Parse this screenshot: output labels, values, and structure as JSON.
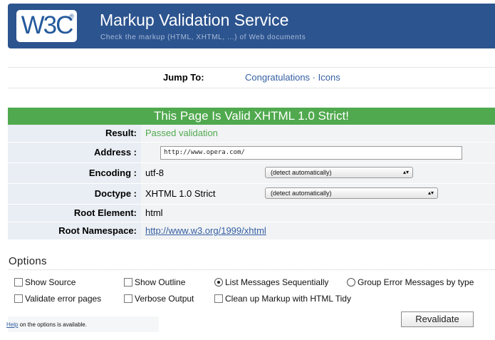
{
  "header": {
    "logo_text": "W3C",
    "logo_reg": "®",
    "title": "Markup Validation Service",
    "subtitle": "Check the markup (HTML, XHTML, ...) of Web documents"
  },
  "jump": {
    "label": "Jump To:",
    "link1": "Congratulations",
    "separator": " · ",
    "link2": "Icons"
  },
  "result": {
    "banner": "This Page Is Valid XHTML 1.0 Strict!",
    "rows": {
      "result_label": "Result:",
      "result_value": "Passed validation",
      "address_label": "Address :",
      "address_value": "http://www.opera.com/",
      "encoding_label": "Encoding :",
      "encoding_value": "utf-8",
      "encoding_select": "(detect automatically)",
      "doctype_label": "Doctype :",
      "doctype_value": "XHTML 1.0 Strict",
      "doctype_select": "(detect automatically)",
      "root_element_label": "Root Element:",
      "root_element_value": "html",
      "root_ns_label": "Root Namespace:",
      "root_ns_value": "http://www.w3.org/1999/xhtml"
    }
  },
  "options": {
    "title": "Options",
    "show_source": "Show Source",
    "show_outline": "Show Outline",
    "list_sequential": "List Messages Sequentially",
    "group_errors": "Group Error Messages by type",
    "validate_error_pages": "Validate error pages",
    "verbose_output": "Verbose Output",
    "clean_up": "Clean up Markup with HTML Tidy",
    "help_link": "Help",
    "help_rest": " on the options is available.",
    "revalidate": "Revalidate"
  },
  "colors": {
    "banner_bg": "#2c548f",
    "valid_green": "#50a94e",
    "link_blue": "#345fa2"
  }
}
